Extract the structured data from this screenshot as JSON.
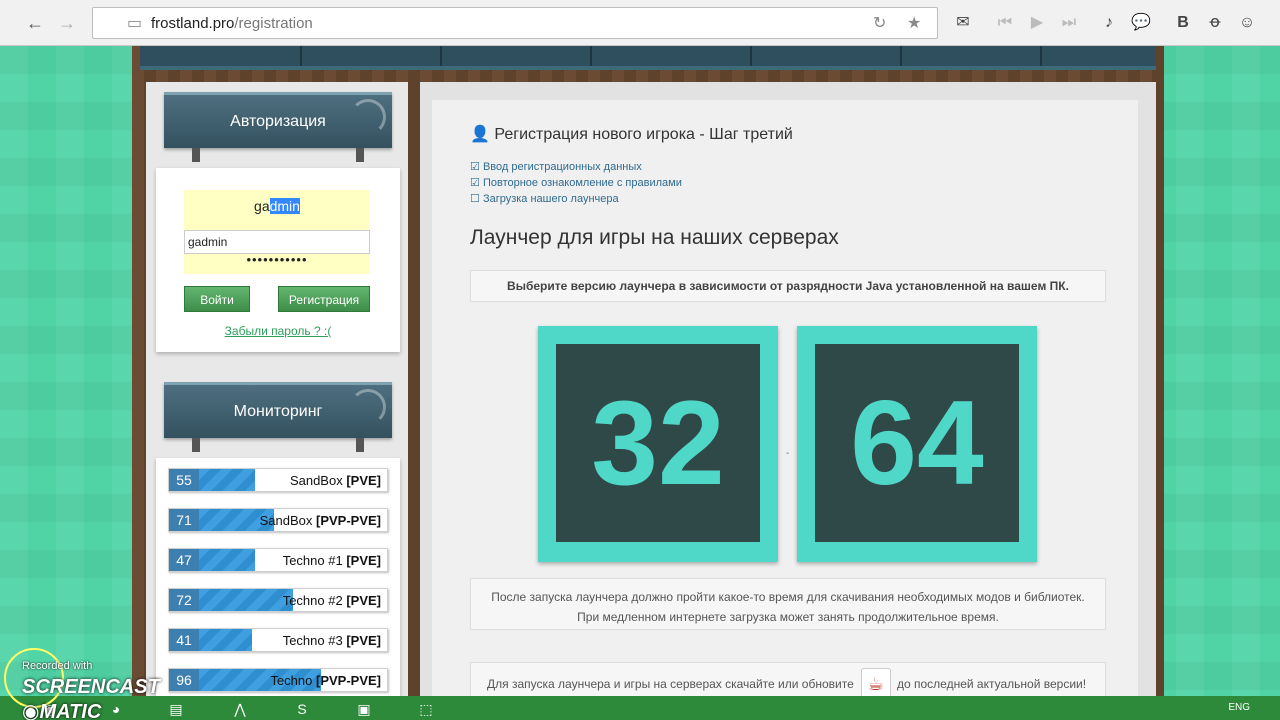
{
  "browser": {
    "url_host": "frostland.pro",
    "url_path": "/registration",
    "back_icon": "arrow-left",
    "forward_icon": "arrow-right",
    "tools_icon": "wrench",
    "page_icon": "document",
    "reload_icon": "reload",
    "star_icon": "star",
    "extensions": [
      "mail",
      "prev",
      "play",
      "next",
      "music",
      "chat",
      "vk",
      "odnoklassniki",
      "friends"
    ]
  },
  "sidebar": {
    "auth_title": "Авторизация",
    "login_value_plain": "ga",
    "login_value_selected": "dmin",
    "autocomplete_suggestion": "gadmin",
    "password_mask": "•••••••••••",
    "login_button": "Войти",
    "register_button": "Регистрация",
    "forgot_link": "Забыли пароль ? :(",
    "monitoring_title": "Мониторинг",
    "servers": [
      {
        "count": "55",
        "name": "SandBox",
        "mode": "[PVE]",
        "fill": 0.3
      },
      {
        "count": "71",
        "name": "SandBox",
        "mode": "[PVP-PVE]",
        "fill": 0.4
      },
      {
        "count": "47",
        "name": "Techno #1",
        "mode": "[PVE]",
        "fill": 0.3
      },
      {
        "count": "72",
        "name": "Techno #2",
        "mode": "[PVE]",
        "fill": 0.5
      },
      {
        "count": "41",
        "name": "Techno #3",
        "mode": "[PVE]",
        "fill": 0.28
      },
      {
        "count": "96",
        "name": "Techno",
        "mode": "[PVP-PVE]",
        "fill": 0.65
      }
    ]
  },
  "main": {
    "title": "Регистрация нового игрока - Шаг третий",
    "steps": [
      {
        "label": "Ввод регистрационных данных",
        "checked": true
      },
      {
        "label": "Повторное ознакомление с правилами",
        "checked": true
      },
      {
        "label": "Загрузка нашего лаунчера",
        "checked": false
      }
    ],
    "heading": "Лаунчер для игры на наших серверах",
    "notice": "Выберите версию лаунчера в зависимости от разрядности Java установленной на вашем ПК.",
    "btn32": "32",
    "btn64": "64",
    "separator": "-",
    "info_line1": "После запуска лаунчера должно пройти какое-то время для скачивания необходимых модов и библиотек.",
    "info_line2": "При медленном интернете загрузка может занять продолжительное время.",
    "java_text1": "Для запуска лаунчера и игры на серверах скачайте или обновите",
    "java_text2": "до последней актуальной версии!"
  },
  "watermark": {
    "small": "Recorded with",
    "big": "SCREENCAST",
    "big2": "MATIC"
  },
  "taskbar": {
    "lang": "ENG"
  },
  "colors": {
    "accent": "#4fd8c8",
    "green_btn": "#3e8e4a",
    "link": "#2f9e5a"
  }
}
